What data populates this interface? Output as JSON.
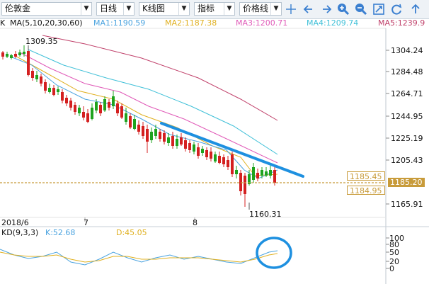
{
  "toolbar": {
    "symbol": "伦敦金",
    "period": "日线",
    "chart_type": "K线图",
    "indicator": "指标",
    "price_line": "价格线"
  },
  "ma_legend": {
    "label": "MA(5,10,20,30,60)",
    "ma1": "MA1:1190.59",
    "ma2": "MA2:1187.38",
    "ma3": "MA3:1200.71",
    "ma4": "MA4:1209.74",
    "ma5": "MA5:1239.9",
    "colors": {
      "ma1": "#4aa3df",
      "ma2": "#e0b020",
      "ma3": "#e05ab8",
      "ma4": "#40c0d8",
      "ma5": "#c0406a"
    }
  },
  "kd_legend": {
    "label": "KD(9,3,3)",
    "k": "K:52.68",
    "d": "D:45.05"
  },
  "price_axis": [
    "1304.24",
    "1284.48",
    "1264.71",
    "1244.95",
    "1225.19",
    "1205.43",
    "1165.91"
  ],
  "kd_axis": [
    "100",
    "80",
    "50",
    "20",
    "0"
  ],
  "price_tags": {
    "line1": "1185.45",
    "current": "1185.20",
    "line2": "1184.95"
  },
  "annotations": {
    "high": "1309.35",
    "low": "1160.31"
  },
  "time_axis": [
    "2018/6",
    "7",
    "8"
  ],
  "colors": {
    "up": "#1fa31f",
    "down": "#d42020",
    "trendline": "#1e90e0",
    "circle": "#1e90e0"
  }
}
